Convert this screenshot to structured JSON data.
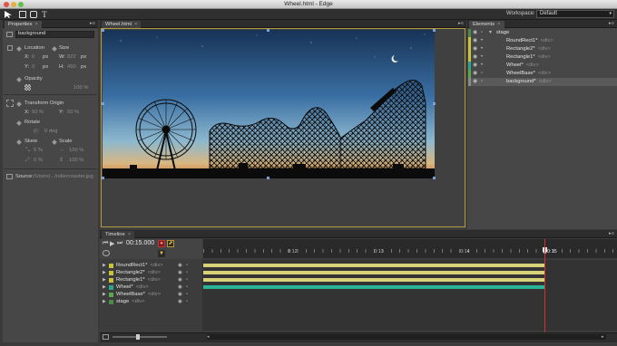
{
  "window": {
    "title": "Wheel.html - Edge"
  },
  "toolbar": {
    "tools": [
      "selection-tool",
      "rectangle-tool",
      "rounded-rectangle-tool",
      "text-tool"
    ],
    "text_tool_glyph": "T",
    "workspace_label": "Workspace:",
    "workspace_value": "Default"
  },
  "properties": {
    "tab_label": "Properties",
    "element_id": "background",
    "location_label": "Location",
    "size_label": "Size",
    "x_label": "X:",
    "x_value": "0",
    "x_unit": "px",
    "y_label": "Y:",
    "y_value": "0",
    "y_unit": "px",
    "w_label": "W:",
    "w_value": "822",
    "w_unit": "px",
    "h_label": "H:",
    "h_value": "450",
    "h_unit": "px",
    "opacity_label": "Opacity",
    "opacity_value": "100 %",
    "transform_origin_label": "Transform Origin",
    "to_x_label": "X:",
    "to_x_value": "50 %",
    "to_y_label": "Y:",
    "to_y_value": "50 %",
    "rotate_label": "Rotate",
    "rotate_value": "0 deg",
    "skew_label": "Skew",
    "scale_label": "Scale",
    "skew_x_value": "0 %",
    "skew_y_value": "0 %",
    "scale_x_value": "100 %",
    "scale_y_value": "100 %",
    "source_label": "Source:",
    "source_value": "/Users/.../rollercoaster.jpg"
  },
  "stage": {
    "tab_label": "Wheel.html"
  },
  "elements": {
    "tab_label": "Elements",
    "rows": [
      {
        "name": "stage",
        "tag": "",
        "color": "#4a8a4a"
      },
      {
        "name": "RoundRect1*",
        "tag": "<div>",
        "color": "#c9c23b"
      },
      {
        "name": "Rectangle2*",
        "tag": "<div>",
        "color": "#c9c23b"
      },
      {
        "name": "Rectangle1*",
        "tag": "<div>",
        "color": "#c9c23b"
      },
      {
        "name": "Wheel*",
        "tag": "<div>",
        "color": "#2aa58f"
      },
      {
        "name": "WheelBase*",
        "tag": "<div>",
        "color": "#5ba84b"
      },
      {
        "name": "background*",
        "tag": "<div>",
        "color": "#8a8a8a"
      }
    ]
  },
  "timeline": {
    "tab_label": "Timeline",
    "time": "00:15.000",
    "ticks": [
      "0:12",
      "0:13",
      "0:14",
      "0:15"
    ],
    "rows": [
      {
        "name": "RoundRect1*",
        "tag": "<div>",
        "color": "#c9c23b"
      },
      {
        "name": "Rectangle2*",
        "tag": "<div>",
        "color": "#c9c23b"
      },
      {
        "name": "Rectangle1*",
        "tag": "<div>",
        "color": "#c9c23b"
      },
      {
        "name": "Wheel*",
        "tag": "<div>",
        "color": "#2aa58f"
      },
      {
        "name": "WheelBase*",
        "tag": "<div>",
        "color": "#5ba84b"
      },
      {
        "name": "stage",
        "tag": "<div>",
        "color": "#4a8a4a"
      }
    ]
  },
  "colors": {
    "accent_gold": "#b49a3a",
    "yellow_track": "#d7d27a",
    "teal_track": "#2bb397",
    "playhead": "#d03030"
  }
}
